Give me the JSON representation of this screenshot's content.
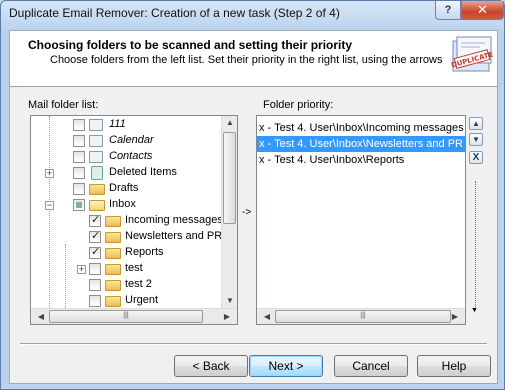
{
  "window": {
    "title": "Duplicate Email Remover: Creation of a new task (Step 2 of 4)",
    "help_label": "?",
    "close_label": "✕"
  },
  "header": {
    "title": "Choosing folders to be scanned and setting their priority",
    "subtitle": "Choose folders from the left list. Set their priority in the right list, using the arrows",
    "logo_text": "DUPLICATE"
  },
  "mail_folder_list": {
    "label": "Mail folder list:",
    "items": [
      {
        "label": "111",
        "italic": true
      },
      {
        "label": "Calendar",
        "italic": true
      },
      {
        "label": "Contacts",
        "italic": true
      },
      {
        "label": "Deleted Items",
        "italic": false
      },
      {
        "label": "Drafts",
        "italic": false
      },
      {
        "label": "Inbox",
        "italic": false
      },
      {
        "label": "Incoming messages",
        "italic": false
      },
      {
        "label": "Newsletters and PR",
        "italic": false
      },
      {
        "label": "Reports",
        "italic": false
      },
      {
        "label": "test",
        "italic": false
      },
      {
        "label": "test 2",
        "italic": false
      },
      {
        "label": "Urgent",
        "italic": false
      }
    ]
  },
  "middle_arrow": "->",
  "folder_priority": {
    "label": "Folder priority:",
    "items": [
      {
        "label": "x - Test 4. User\\Inbox\\Incoming messages",
        "selected": false
      },
      {
        "label": "x - Test 4. User\\Inbox\\Newsletters and PR",
        "selected": true
      },
      {
        "label": "x - Test 4. User\\Inbox\\Reports",
        "selected": false
      }
    ],
    "up_label": "▲",
    "down_label": "▼",
    "remove_label": "X"
  },
  "buttons": {
    "back": "< Back",
    "next": "Next >",
    "cancel": "Cancel",
    "help": "Help"
  },
  "colors": {
    "selection": "#3399ff",
    "folder": "#f3d36e"
  }
}
